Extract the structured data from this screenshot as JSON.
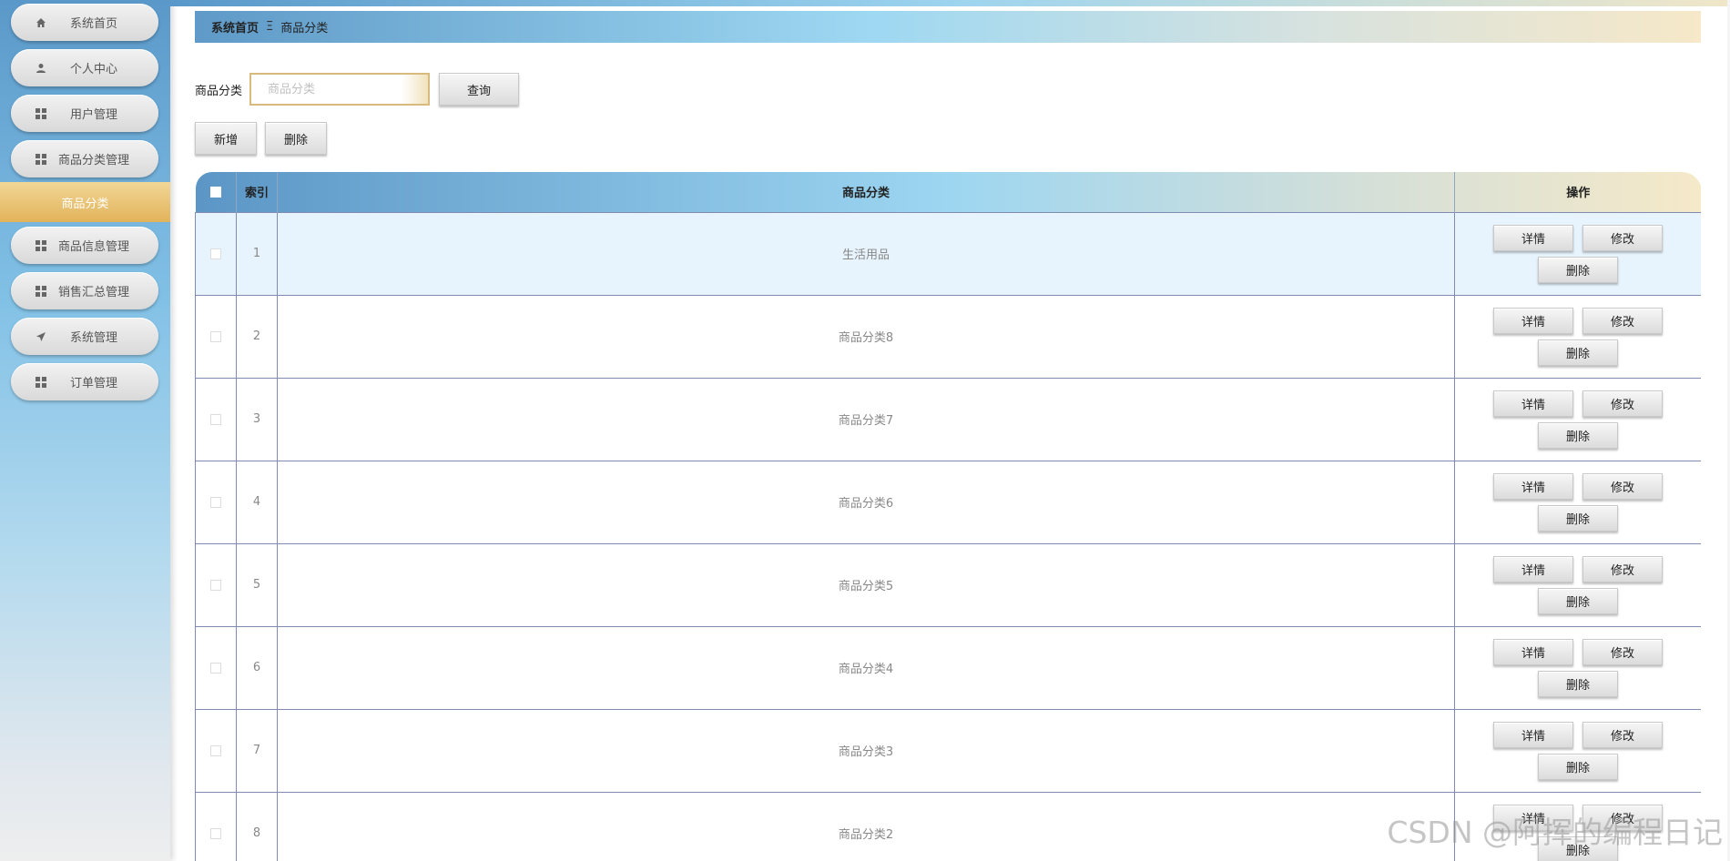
{
  "sidebar": {
    "items": [
      {
        "label": "系统首页",
        "icon": "home-icon"
      },
      {
        "label": "个人中心",
        "icon": "user-icon"
      },
      {
        "label": "用户管理",
        "icon": "grid-icon"
      },
      {
        "label": "商品分类管理",
        "icon": "grid-icon"
      },
      {
        "label": "商品信息管理",
        "icon": "grid-icon"
      },
      {
        "label": "销售汇总管理",
        "icon": "grid-icon"
      },
      {
        "label": "系统管理",
        "icon": "send-icon"
      },
      {
        "label": "订单管理",
        "icon": "grid-icon"
      }
    ],
    "active_sub": "商品分类"
  },
  "breadcrumb": {
    "home": "系统首页",
    "separator": "Ξ",
    "current": "商品分类"
  },
  "search": {
    "label": "商品分类",
    "placeholder": "商品分类",
    "value": "",
    "button": "查询"
  },
  "actions": {
    "add": "新增",
    "delete": "删除"
  },
  "table": {
    "headers": {
      "index": "索引",
      "category": "商品分类",
      "ops": "操作"
    },
    "row_buttons": {
      "detail": "详情",
      "edit": "修改",
      "delete": "删除"
    },
    "rows": [
      {
        "index": "1",
        "category": "生活用品"
      },
      {
        "index": "2",
        "category": "商品分类8"
      },
      {
        "index": "3",
        "category": "商品分类7"
      },
      {
        "index": "4",
        "category": "商品分类6"
      },
      {
        "index": "5",
        "category": "商品分类5"
      },
      {
        "index": "6",
        "category": "商品分类4"
      },
      {
        "index": "7",
        "category": "商品分类3"
      },
      {
        "index": "8",
        "category": "商品分类2"
      }
    ]
  },
  "watermark": "CSDN @阿挥的编程日记",
  "colors": {
    "accent": "#e2b35a",
    "sidebar": "#82c1e6",
    "row_highlight": "#e8f4fd",
    "border": "#7f8bb0"
  }
}
